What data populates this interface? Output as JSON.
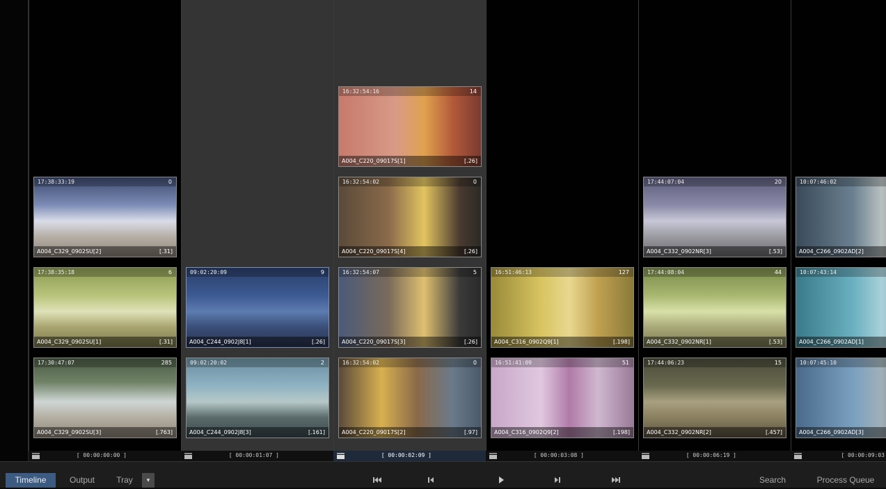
{
  "tabs": {
    "timeline": "Timeline",
    "output": "Output",
    "tray": "Tray",
    "dropdown": "▾"
  },
  "right_buttons": {
    "search": "Search",
    "process_queue": "Process Queue"
  },
  "transport": [
    "skip-to-start-icon",
    "step-back-icon",
    "play-icon",
    "step-forward-icon",
    "skip-to-end-icon"
  ],
  "columns": [
    {
      "footer_time": "[ 00:00:00:00 ]",
      "active": false,
      "tiles": [
        {
          "tc": "17:38:33:19",
          "num": "0",
          "clip": "A004_C329_0902SU[2]",
          "dur": "[.31]"
        },
        {
          "tc": "17:38:35:18",
          "num": "6",
          "clip": "A004_C329_0902SU[1]",
          "dur": "[.31]"
        },
        {
          "tc": "17:30:47:07",
          "num": "285",
          "clip": "A004_C329_0902SU[3]",
          "dur": "[.763]"
        }
      ]
    },
    {
      "footer_time": "[ 00:00:01:07 ]",
      "active": false,
      "tiles": [
        {
          "tc": "09:02:20:09",
          "num": "9",
          "clip": "A004_C244_0902J8[1]",
          "dur": "[.26]"
        },
        {
          "tc": "09:02:20:02",
          "num": "2",
          "clip": "A004_C244_0902J8[3]",
          "dur": "[.161]"
        }
      ]
    },
    {
      "footer_time": "[ 00:00:02:09 ]",
      "active": true,
      "tiles": [
        {
          "tc": "16:32:54:16",
          "num": "14",
          "clip": "A004_C220_09017S[1]",
          "dur": "[.26]"
        },
        {
          "tc": "16:32:54:02",
          "num": "0",
          "clip": "A004_C220_09017S[4]",
          "dur": "[.26]"
        },
        {
          "tc": "16:32:54:07",
          "num": "5",
          "clip": "A004_C220_09017S[3]",
          "dur": "[.26]"
        },
        {
          "tc": "16:32:54:02",
          "num": "0",
          "clip": "A004_C220_09017S[2]",
          "dur": "[.97]"
        }
      ]
    },
    {
      "footer_time": "[ 00:00:03:08 ]",
      "active": false,
      "tiles": [
        {
          "tc": "16:51:46:13",
          "num": "127",
          "clip": "A004_C316_0902Q9[1]",
          "dur": "[.198]"
        },
        {
          "tc": "16:51:41:09",
          "num": "51",
          "clip": "A004_C316_0902Q9[2]",
          "dur": "[.198]"
        }
      ]
    },
    {
      "footer_time": "[ 00:00:06:19 ]",
      "active": false,
      "tiles": [
        {
          "tc": "17:44:07:04",
          "num": "20",
          "clip": "A004_C332_0902NR[3]",
          "dur": "[.53]"
        },
        {
          "tc": "17:44:08:04",
          "num": "44",
          "clip": "A004_C332_0902NR[1]",
          "dur": "[.53]"
        },
        {
          "tc": "17:44:06:23",
          "num": "15",
          "clip": "A004_C332_0902NR[2]",
          "dur": "[.457]"
        }
      ]
    },
    {
      "footer_time": "[ 00:00:09:03",
      "active": false,
      "tiles": [
        {
          "tc": "10:07:46:02",
          "num": "",
          "clip": "A004_C266_0902AD[2]",
          "dur": ""
        },
        {
          "tc": "10:07:43:14",
          "num": "",
          "clip": "A004_C266_0902AD[1]",
          "dur": ""
        },
        {
          "tc": "10:07:45:10",
          "num": "",
          "clip": "A004_C266_0902AD[3]",
          "dur": ""
        }
      ]
    }
  ]
}
